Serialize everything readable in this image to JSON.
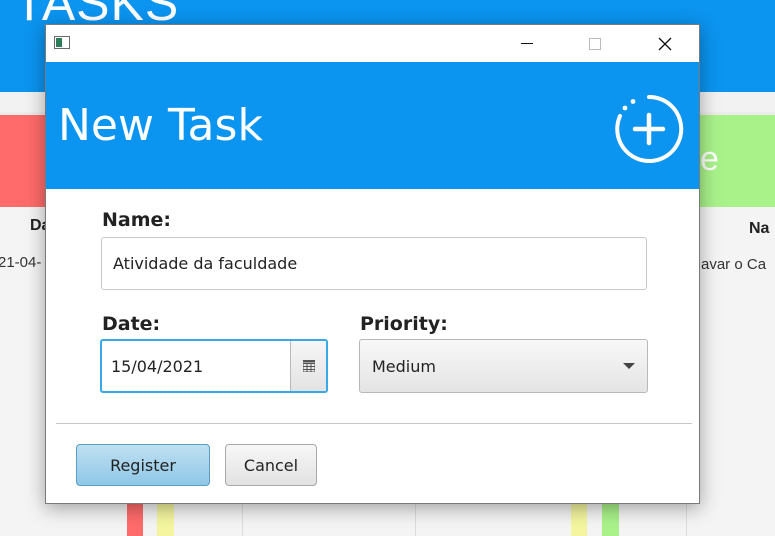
{
  "background": {
    "app_title": "TASKS",
    "green_card_letter": "e",
    "left_column_header": "Da",
    "right_column_header": "Na",
    "left_cell": "21-04-",
    "right_cell": "avar o Ca"
  },
  "dialog": {
    "header_title": "New Task",
    "form": {
      "name_label": "Name:",
      "name_value": "Atividade da faculdade",
      "date_label": "Date:",
      "date_value": "15/04/2021",
      "priority_label": "Priority:",
      "priority_value": "Medium"
    },
    "buttons": {
      "register": "Register",
      "cancel": "Cancel"
    }
  },
  "colors": {
    "accent": "#0b94f0",
    "priority_high": "#ff6b6b",
    "priority_low": "#a9f28a",
    "focus_border": "#38a8e6"
  },
  "icons": {
    "add": "add-circle-icon",
    "calendar": "calendar-icon",
    "app": "app-icon",
    "minimize": "minimize-icon",
    "maximize": "maximize-icon",
    "close": "close-icon",
    "dropdown": "chevron-down-icon"
  }
}
